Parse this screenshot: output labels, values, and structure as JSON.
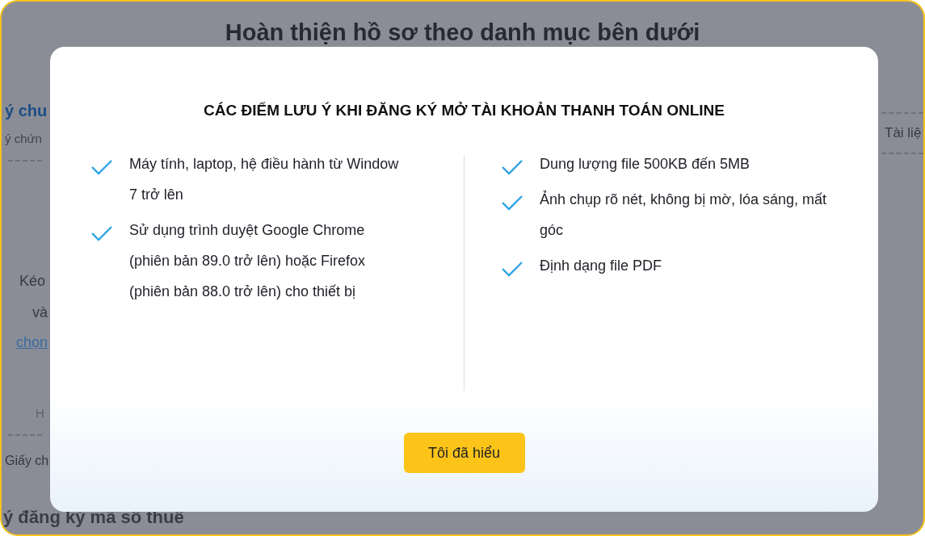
{
  "background": {
    "heading": "Hoàn thiện hồ sơ theo danh mục bên dưới",
    "left_fragments": [
      {
        "kind": "heading",
        "text": "ý chu"
      },
      {
        "kind": "subtext",
        "text": "ý chứn"
      },
      {
        "kind": "divider"
      },
      {
        "kind": "text",
        "text": "Kéo"
      },
      {
        "kind": "text",
        "text": "và"
      },
      {
        "kind": "link",
        "text": "chọn"
      },
      {
        "kind": "faint",
        "text": "H"
      },
      {
        "kind": "divider"
      },
      {
        "kind": "text",
        "text": "Giấy ch"
      }
    ],
    "right_fragments": [
      {
        "kind": "divider"
      },
      {
        "kind": "text",
        "text": "Tài liệ"
      },
      {
        "kind": "divider"
      }
    ],
    "bottom_fragment": "ý đăng ký mã số thuế"
  },
  "dialog": {
    "title": "CÁC ĐIỂM LƯU Ý KHI ĐĂNG KÝ MỞ TÀI KHOẢN THANH TOÁN ONLINE",
    "columns": [
      {
        "items": [
          "Máy tính, laptop, hệ điều hành từ Window 7 trở lên",
          "Sử dụng trình duyệt Google Chrome (phiên bản 89.0 trở lên) hoặc Firefox (phiên bản 88.0 trở lên) cho thiết bị"
        ]
      },
      {
        "items": [
          "Dung lượng file 500KB đến 5MB",
          "Ảnh chụp rõ nét, không bị mờ, lóa sáng, mất góc",
          "Định dạng file PDF"
        ]
      }
    ],
    "button": "Tôi đã hiểu"
  }
}
